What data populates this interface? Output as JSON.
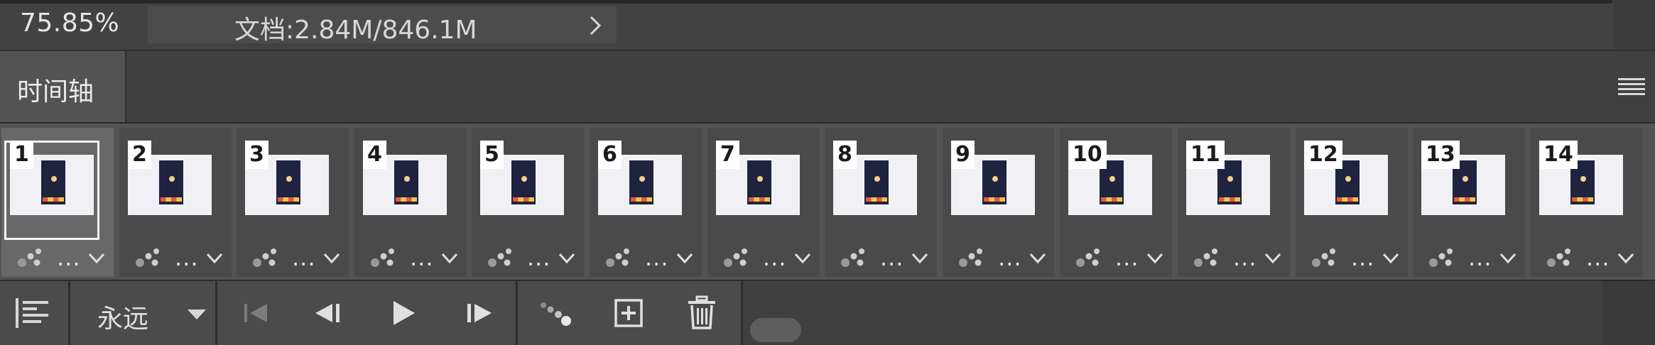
{
  "status_bar": {
    "zoom": "75.85%",
    "doc_info": "文档:2.84M/846.1M"
  },
  "panel": {
    "tab_label": "时间轴"
  },
  "frames": [
    {
      "number": "1",
      "delay": "...",
      "selected": true
    },
    {
      "number": "2",
      "delay": "...",
      "selected": false
    },
    {
      "number": "3",
      "delay": "...",
      "selected": false
    },
    {
      "number": "4",
      "delay": "...",
      "selected": false
    },
    {
      "number": "5",
      "delay": "...",
      "selected": false
    },
    {
      "number": "6",
      "delay": "...",
      "selected": false
    },
    {
      "number": "7",
      "delay": "...",
      "selected": false
    },
    {
      "number": "8",
      "delay": "...",
      "selected": false
    },
    {
      "number": "9",
      "delay": "...",
      "selected": false
    },
    {
      "number": "10",
      "delay": "...",
      "selected": false
    },
    {
      "number": "11",
      "delay": "...",
      "selected": false
    },
    {
      "number": "12",
      "delay": "...",
      "selected": false
    },
    {
      "number": "13",
      "delay": "...",
      "selected": false
    },
    {
      "number": "14",
      "delay": "...",
      "selected": false
    }
  ],
  "toolbar": {
    "loop_option": "永远",
    "icons": [
      "convert-to-video-timeline-icon",
      "loop-dropdown-arrow-icon",
      "first-frame-icon",
      "previous-frame-icon",
      "play-icon",
      "next-frame-icon",
      "tween-icon",
      "duplicate-frame-icon",
      "delete-frame-icon"
    ]
  },
  "colors": {
    "background": "#353535",
    "panel": "#535353",
    "frame_bg": "#4a4a4a",
    "frame_selected_bg": "#686868",
    "text": "#d8d8d8"
  }
}
